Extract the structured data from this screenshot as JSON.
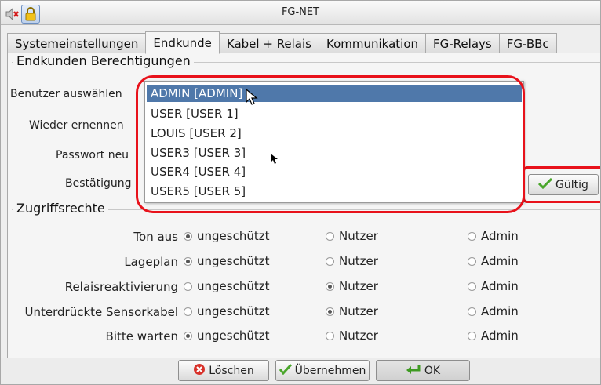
{
  "window": {
    "title": "FG-NET"
  },
  "tabs": [
    {
      "label": "Systemeinstellungen",
      "active": false
    },
    {
      "label": "Endkunde",
      "active": true
    },
    {
      "label": "Kabel + Relais",
      "active": false
    },
    {
      "label": "Kommunikation",
      "active": false
    },
    {
      "label": "FG-Relays",
      "active": false
    },
    {
      "label": "FG-BBc",
      "active": false
    }
  ],
  "section1": {
    "title": "Endkunden Berechtigungen",
    "fields": {
      "user_select": "Benutzer auswählen",
      "renew": "Wieder ernennen",
      "password_new": "Passwort neu",
      "confirm": "Bestätigung"
    },
    "valid_button": "Gültig"
  },
  "dropdown": {
    "options": [
      "ADMIN [ADMIN]",
      "USER [USER 1]",
      "LOUIS [USER 2]",
      "USER3 [USER 3]",
      "USER4 [USER 4]",
      "USER5 [USER 5]"
    ],
    "selected_index": 0
  },
  "section2": {
    "title": "Zugriffsrechte",
    "columns": [
      "ungeschützt",
      "Nutzer",
      "Admin"
    ],
    "rows": [
      {
        "label": "Ton aus",
        "selected": 0
      },
      {
        "label": "Lageplan",
        "selected": 0
      },
      {
        "label": "Relaisreaktivierung",
        "selected": 1
      },
      {
        "label": "Unterdrückte Sensorkabel",
        "selected": 1
      },
      {
        "label": "Bitte warten",
        "selected": 0
      }
    ]
  },
  "footer": {
    "delete": "Löschen",
    "apply": "Übernehmen",
    "ok": "OK"
  },
  "colors": {
    "highlight": "#e8121b",
    "selection": "#4f78aa"
  }
}
